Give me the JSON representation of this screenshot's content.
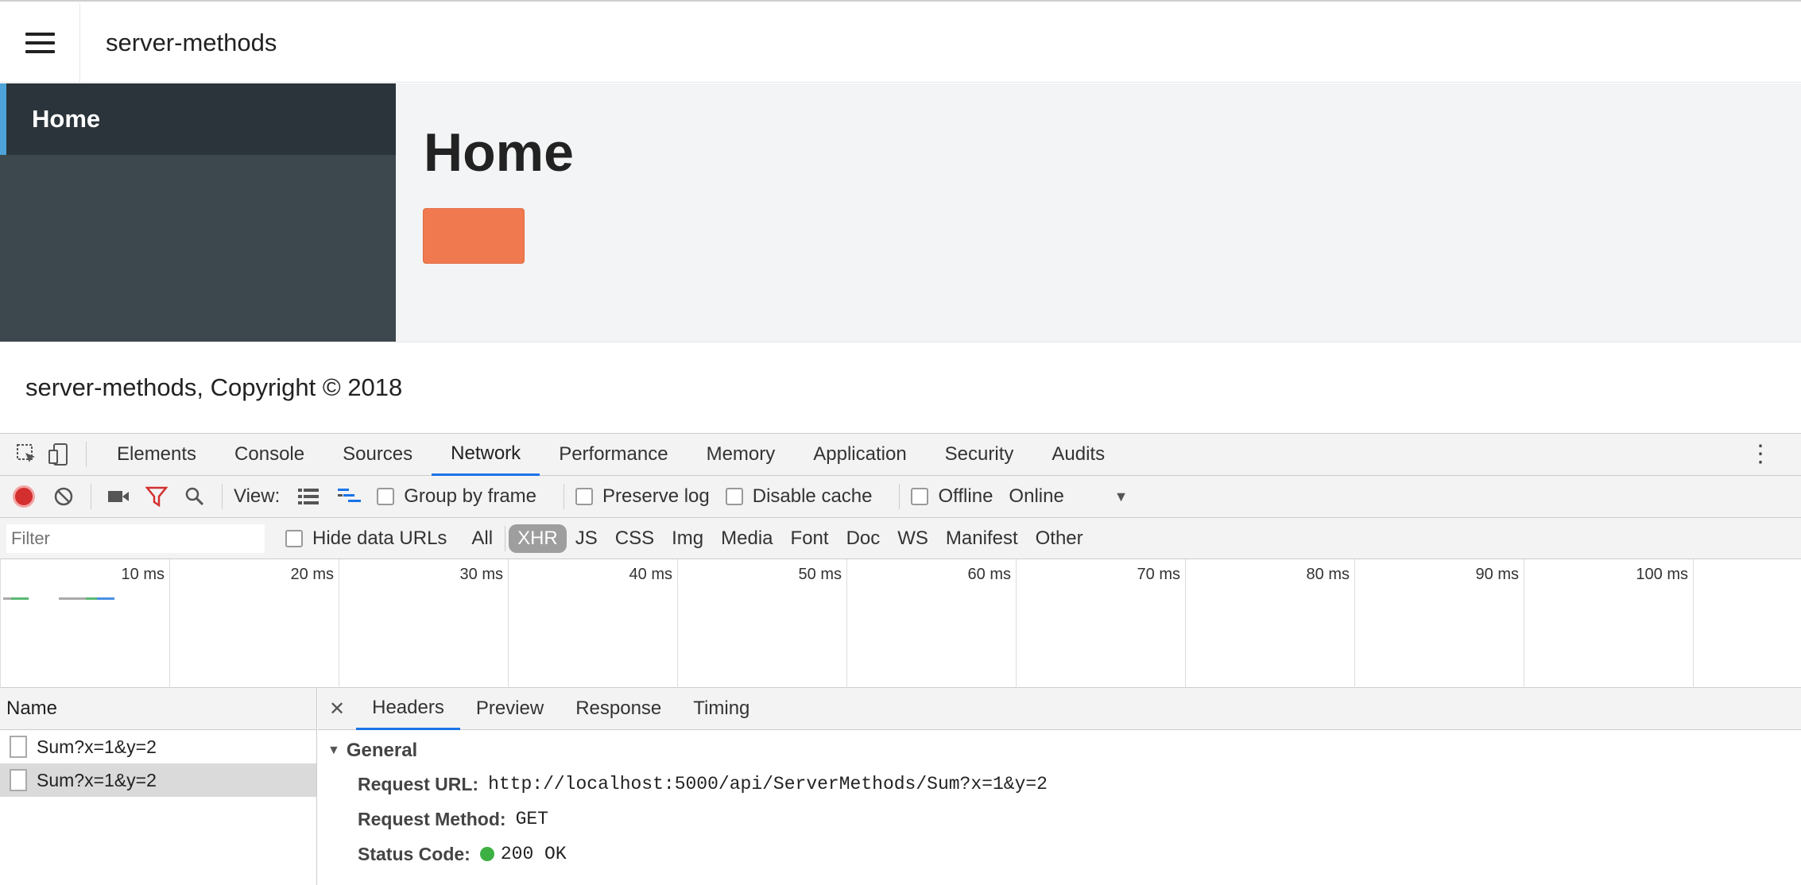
{
  "app": {
    "title": "server-methods"
  },
  "sidebar": {
    "items": [
      {
        "label": "Home"
      }
    ]
  },
  "main": {
    "title": "Home"
  },
  "footer": {
    "text": "server-methods, Copyright © 2018"
  },
  "devtools": {
    "tabs": [
      "Elements",
      "Console",
      "Sources",
      "Network",
      "Performance",
      "Memory",
      "Application",
      "Security",
      "Audits"
    ],
    "active_tab": "Network",
    "toolbar": {
      "view_label": "View:",
      "group_by_frame": "Group by frame",
      "preserve_log": "Preserve log",
      "disable_cache": "Disable cache",
      "offline": "Offline",
      "throttle": "Online"
    },
    "filter": {
      "placeholder": "Filter",
      "hide_data_urls": "Hide data URLs",
      "types": [
        "All",
        "XHR",
        "JS",
        "CSS",
        "Img",
        "Media",
        "Font",
        "Doc",
        "WS",
        "Manifest",
        "Other"
      ],
      "active_type": "XHR"
    },
    "timeline": {
      "ticks": [
        "10 ms",
        "20 ms",
        "30 ms",
        "40 ms",
        "50 ms",
        "60 ms",
        "70 ms",
        "80 ms",
        "90 ms",
        "100 ms"
      ]
    },
    "requests": {
      "header": "Name",
      "rows": [
        {
          "name": "Sum?x=1&y=2"
        },
        {
          "name": "Sum?x=1&y=2"
        }
      ]
    },
    "details": {
      "tabs": [
        "Headers",
        "Preview",
        "Response",
        "Timing"
      ],
      "general_label": "General",
      "request_url_label": "Request URL:",
      "request_url": "http://localhost:5000/api/ServerMethods/Sum?x=1&y=2",
      "request_method_label": "Request Method:",
      "request_method": "GET",
      "status_code_label": "Status Code:",
      "status_code": "200 OK"
    }
  }
}
